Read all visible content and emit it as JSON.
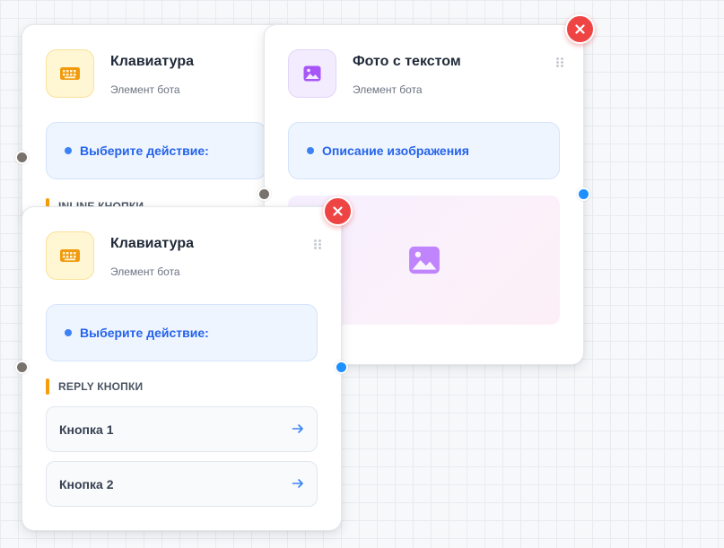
{
  "canvas": {
    "nodes": {
      "keyboard_back": {
        "title": "Клавиатура",
        "subtitle": "Элемент бота",
        "icon": "keyboard-icon",
        "message": "Выберите действие:",
        "section_label": "INLINE КНОПКИ"
      },
      "photo": {
        "title": "Фото с текстом",
        "subtitle": "Элемент бота",
        "icon": "image-icon",
        "message": "Описание изображения",
        "preview_icon": "image-icon"
      },
      "keyboard_front": {
        "title": "Клавиатура",
        "subtitle": "Элемент бота",
        "icon": "keyboard-icon",
        "message": "Выберите действие:",
        "section_label": "REPLY КНОПКИ",
        "buttons": [
          {
            "label": "Кнопка 1",
            "icon": "arrow-right-icon"
          },
          {
            "label": "Кнопка 2",
            "icon": "arrow-right-icon"
          }
        ]
      }
    },
    "colors": {
      "accent_blue": "#3b82f6",
      "delete_red": "#ef4444",
      "section_marker": "#f59e0b",
      "input_port": "#78716c",
      "output_port": "#1e90ff"
    }
  }
}
